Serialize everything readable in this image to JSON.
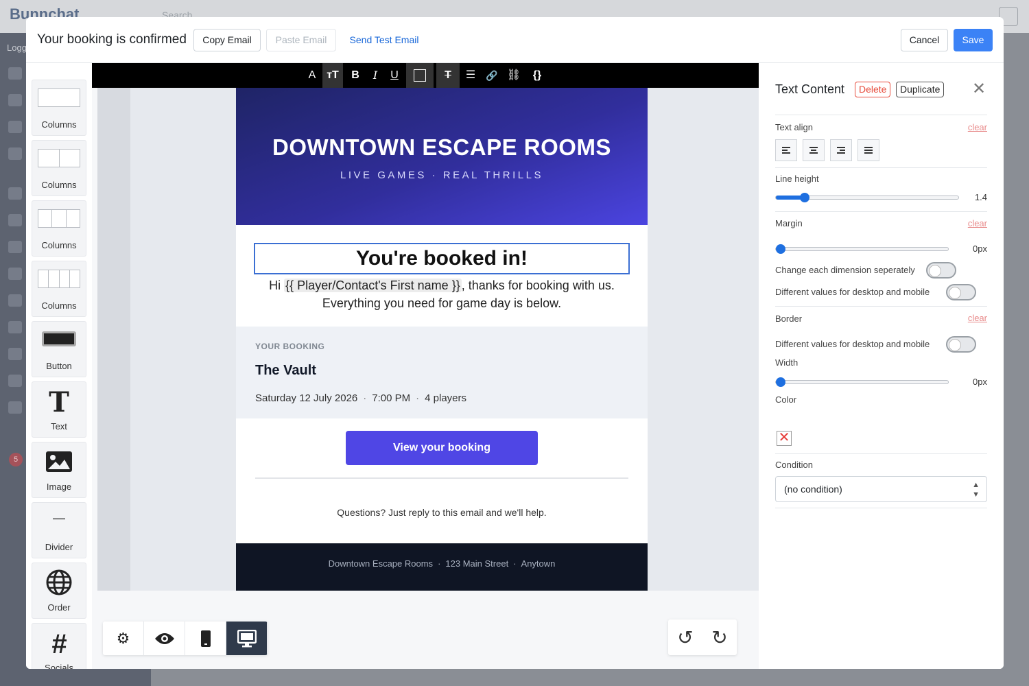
{
  "background": {
    "app_name": "Bunnchat",
    "search_placeholder": "Search",
    "logged_in_label": "Logg",
    "notification_count": "5"
  },
  "header": {
    "title": "Your booking is confirmed",
    "copy_email": "Copy Email",
    "paste_email": "Paste Email",
    "send_test_email": "Send Test Email",
    "cancel": "Cancel",
    "save": "Save"
  },
  "blocks": [
    {
      "label": "Columns",
      "type": "columns-1"
    },
    {
      "label": "Columns",
      "type": "columns-2"
    },
    {
      "label": "Columns",
      "type": "columns-3"
    },
    {
      "label": "Columns",
      "type": "columns-4"
    },
    {
      "label": "Button",
      "type": "button"
    },
    {
      "label": "Text",
      "type": "text",
      "icon": "T"
    },
    {
      "label": "Image",
      "type": "image"
    },
    {
      "label": "Divider",
      "type": "divider",
      "icon": "—"
    },
    {
      "label": "Order",
      "type": "order"
    },
    {
      "label": "Socials",
      "type": "socials",
      "icon": "#"
    }
  ],
  "toolbar": {
    "font_icon": "A",
    "text_size_icon": "тT",
    "bold_icon": "B",
    "italic_icon": "I",
    "underline_icon": "U",
    "list_icon": "☰",
    "link_icon": "🔗",
    "braces_icon": "{}"
  },
  "email": {
    "hero_title": "DOWNTOWN ESCAPE ROOMS",
    "hero_subtitle": "LIVE GAMES · REAL THRILLS",
    "headline": "You're booked in!",
    "intro_prefix": "Hi ",
    "merge_tag": "{{  Player/Contact's First name }}",
    "intro_suffix": ", thanks for booking with us.",
    "intro_line2": "Everything you need for game day is below.",
    "booking_label": "YOUR BOOKING",
    "booking_name": "The Vault",
    "booking_date": "Saturday 12 July 2026",
    "booking_time": "7:00 PM",
    "booking_players": "4 players",
    "meta_separator": "·",
    "cta": "View your booking",
    "questions": "Questions? Just reply to this email and we'll help.",
    "footer_name": "Downtown Escape Rooms",
    "footer_street": "123 Main Street",
    "footer_town": "Anytown",
    "colors": {
      "hero_start": "#1f2466",
      "hero_end": "#4b44e0",
      "cta": "#4f46e5",
      "footer": "#0f1524"
    }
  },
  "panel": {
    "title": "Text Content",
    "delete": "Delete",
    "duplicate": "Duplicate",
    "text_align_label": "Text align",
    "clear": "clear",
    "line_height_label": "Line height",
    "line_height_value": "1.4",
    "margin_label": "Margin",
    "margin_value": "0px",
    "change_each_dimension": "Change each dimension seperately",
    "different_values": "Different values for desktop and mobile",
    "border_label": "Border",
    "width_label": "Width",
    "width_value": "0px",
    "color_label": "Color",
    "condition_label": "Condition",
    "condition_value": "(no condition)"
  }
}
